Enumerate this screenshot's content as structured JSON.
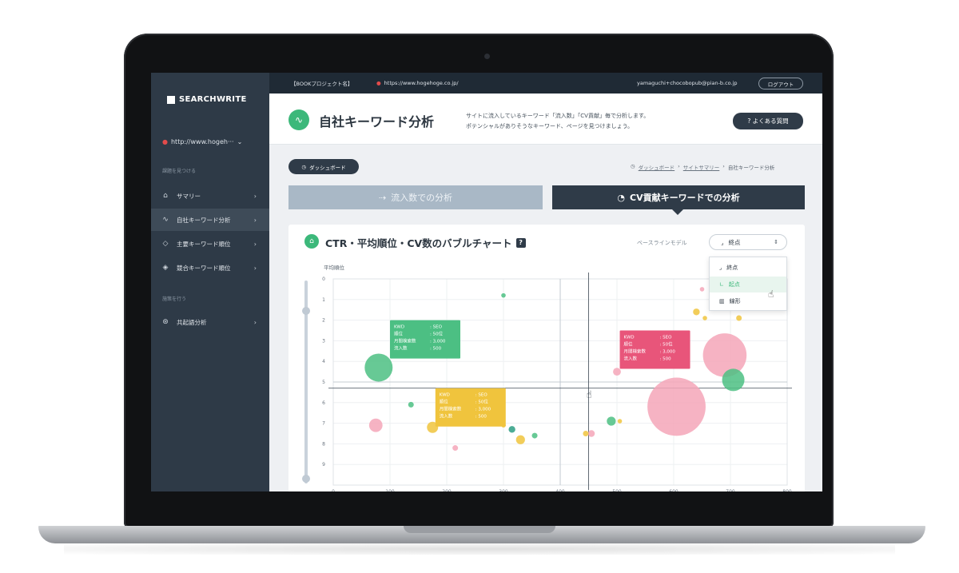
{
  "sidebar": {
    "logo": "SEARCHWRITE",
    "site": "http://www.hogeh···",
    "section1": "課題を見つける",
    "section2": "施策を行う",
    "items": [
      {
        "label": "サマリー"
      },
      {
        "label": "自社キーワード分析"
      },
      {
        "label": "主要キーワード順位"
      },
      {
        "label": "競合キーワード順位"
      },
      {
        "label": "共起語分析"
      }
    ]
  },
  "topbar": {
    "project": "【BOOKプロジェクト名】",
    "url": "https://www.hogehoge.co.jp/",
    "user": "yamaguchi+chocobopub@pian-b.co.jp",
    "logout": "ログアウト"
  },
  "header": {
    "title": "自社キーワード分析",
    "desc1": "サイトに流入しているキーワード「流入数」「CV貢献」毎で分析します。",
    "desc2": "ポテンシャルがありそうなキーワード、ページを見つけましょう。",
    "faq": "? よくある質問"
  },
  "nav": {
    "dashboard": "ダッシュボード",
    "crumb1": "ダッシュボード",
    "crumb2": "サイトサマリー",
    "crumb3": "自社キーワード分析"
  },
  "tabs": {
    "inflow": "流入数での分析",
    "cv": "CV貢献キーワードでの分析"
  },
  "panel": {
    "title": "CTR・平均順位・CV数のバブルチャート",
    "help": "?",
    "baseline_label": "ベースラインモデル",
    "model_selected": "終点",
    "options": [
      "終点",
      "起点",
      "線形"
    ]
  },
  "colors": {
    "green": "#4cbf83",
    "pink": "#f4a6b8",
    "yellow": "#f0c43d",
    "red": "#e8557a",
    "teal": "#2d9d83"
  },
  "chart_data": {
    "type": "scatter",
    "ylabel": "平均順位",
    "x_ticks": [
      0,
      100,
      200,
      300,
      400,
      500,
      600,
      700,
      800
    ],
    "y_ticks": [
      0,
      1,
      2,
      3,
      4,
      5,
      6,
      7,
      8,
      9
    ],
    "xlim": [
      0,
      800
    ],
    "ylim": [
      0,
      10
    ],
    "y_inverted": true,
    "crosshair": {
      "x": 450,
      "y": 5.3
    },
    "bubbles": [
      {
        "x": 80,
        "y": 4.3,
        "r": 2.5,
        "color": "green"
      },
      {
        "x": 75,
        "y": 7.1,
        "r": 1.2,
        "color": "pink"
      },
      {
        "x": 175,
        "y": 7.2,
        "r": 1,
        "color": "yellow"
      },
      {
        "x": 137,
        "y": 6.1,
        "r": 0.5,
        "color": "green"
      },
      {
        "x": 215,
        "y": 8.2,
        "r": 0.5,
        "color": "pink"
      },
      {
        "x": 300,
        "y": 7.1,
        "r": 0.4,
        "color": "yellow"
      },
      {
        "x": 315,
        "y": 7.3,
        "r": 0.6,
        "color": "teal"
      },
      {
        "x": 330,
        "y": 7.8,
        "r": 0.8,
        "color": "yellow"
      },
      {
        "x": 355,
        "y": 7.6,
        "r": 0.5,
        "color": "green"
      },
      {
        "x": 300,
        "y": 0.8,
        "r": 0.4,
        "color": "green"
      },
      {
        "x": 455,
        "y": 7.5,
        "r": 0.6,
        "color": "pink"
      },
      {
        "x": 445,
        "y": 7.5,
        "r": 0.5,
        "color": "yellow"
      },
      {
        "x": 490,
        "y": 6.9,
        "r": 0.8,
        "color": "green"
      },
      {
        "x": 505,
        "y": 6.9,
        "r": 0.4,
        "color": "yellow"
      },
      {
        "x": 500,
        "y": 4.5,
        "r": 0.7,
        "color": "pink"
      },
      {
        "x": 605,
        "y": 6.2,
        "r": 5.2,
        "color": "pink"
      },
      {
        "x": 690,
        "y": 3.7,
        "r": 3.9,
        "color": "pink"
      },
      {
        "x": 705,
        "y": 4.9,
        "r": 2.0,
        "color": "green"
      },
      {
        "x": 640,
        "y": 1.6,
        "r": 0.6,
        "color": "yellow"
      },
      {
        "x": 655,
        "y": 1.9,
        "r": 0.4,
        "color": "yellow"
      },
      {
        "x": 715,
        "y": 1.9,
        "r": 0.5,
        "color": "yellow"
      },
      {
        "x": 650,
        "y": 0.5,
        "r": 0.4,
        "color": "pink"
      }
    ],
    "tooltips": [
      {
        "anchor_x": 100,
        "anchor_y": 2,
        "color": "green",
        "rows": [
          [
            "KWD",
            ": SEO"
          ],
          [
            "順位",
            ": 50位"
          ],
          [
            "月間検索数",
            ": 3,000"
          ],
          [
            "流入数",
            ": 500"
          ]
        ]
      },
      {
        "anchor_x": 180,
        "anchor_y": 5.3,
        "color": "yellow",
        "rows": [
          [
            "KWD",
            ": SEO"
          ],
          [
            "順位",
            ": 50位"
          ],
          [
            "月間検索数",
            ": 3,000"
          ],
          [
            "流入数",
            ": 500"
          ]
        ]
      },
      {
        "anchor_x": 505,
        "anchor_y": 2.5,
        "color": "red",
        "rows": [
          [
            "KWD",
            ": SEO"
          ],
          [
            "順位",
            ": 50位"
          ],
          [
            "月間検索数",
            ": 3,000"
          ],
          [
            "流入数",
            ": 500"
          ]
        ]
      }
    ]
  }
}
